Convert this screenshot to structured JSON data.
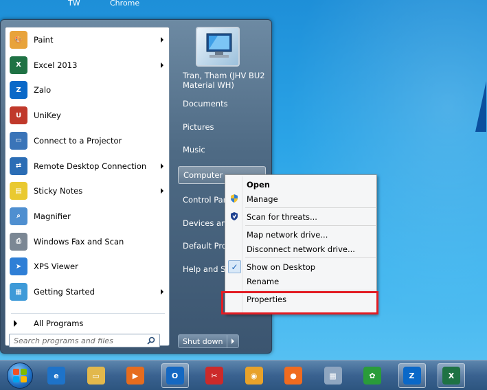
{
  "top_labels": [
    "TW",
    "Chrome"
  ],
  "start_menu": {
    "programs": [
      {
        "label": "Paint",
        "icon": "paint-icon",
        "color": "#e8a33b",
        "glyph": "🎨",
        "submenu": true
      },
      {
        "label": "Excel 2013",
        "icon": "excel-icon",
        "color": "#1f7244",
        "glyph": "X",
        "submenu": true
      },
      {
        "label": "Zalo",
        "icon": "zalo-icon",
        "color": "#0a68c8",
        "glyph": "Z",
        "submenu": false
      },
      {
        "label": "UniKey",
        "icon": "unikey-icon",
        "color": "#c0392b",
        "glyph": "U",
        "submenu": false
      },
      {
        "label": "Connect to a Projector",
        "icon": "projector-icon",
        "color": "#3a74b8",
        "glyph": "▭",
        "submenu": false
      },
      {
        "label": "Remote Desktop Connection",
        "icon": "remote-desktop-icon",
        "color": "#2b6db5",
        "glyph": "⇄",
        "submenu": true
      },
      {
        "label": "Sticky Notes",
        "icon": "sticky-notes-icon",
        "color": "#e9c930",
        "glyph": "▤",
        "submenu": true
      },
      {
        "label": "Magnifier",
        "icon": "magnifier-icon",
        "color": "#4f8fd0",
        "glyph": "⌕",
        "submenu": false
      },
      {
        "label": "Windows Fax and Scan",
        "icon": "fax-scan-icon",
        "color": "#7b8794",
        "glyph": "⎙",
        "submenu": false
      },
      {
        "label": "XPS Viewer",
        "icon": "xps-viewer-icon",
        "color": "#2f7fd6",
        "glyph": "➤",
        "submenu": false
      },
      {
        "label": "Getting Started",
        "icon": "getting-started-icon",
        "color": "#3e9ad8",
        "glyph": "▦",
        "submenu": true
      }
    ],
    "all_programs_label": "All Programs",
    "search_placeholder": "Search programs and files",
    "right_items": [
      {
        "label": "Tran, Tham (JHV BU2 Material WH)",
        "kind": "user"
      },
      {
        "label": "Documents"
      },
      {
        "label": "Pictures"
      },
      {
        "label": "Music"
      },
      {
        "label": "Computer",
        "highlight": true
      },
      {
        "label": "Control Panel"
      },
      {
        "label": "Devices and Printers"
      },
      {
        "label": "Default Programs"
      },
      {
        "label": "Help and Support"
      }
    ],
    "shutdown_label": "Shut down"
  },
  "context_menu": {
    "items": [
      {
        "label": "Open",
        "bold": true
      },
      {
        "label": "Manage",
        "icon": "uac-shield-icon"
      },
      {
        "separator": true
      },
      {
        "label": "Scan for threats...",
        "icon": "defender-shield-icon"
      },
      {
        "separator": true
      },
      {
        "label": "Map network drive..."
      },
      {
        "label": "Disconnect network drive..."
      },
      {
        "separator": true
      },
      {
        "label": "Show on Desktop",
        "checked": true
      },
      {
        "label": "Rename"
      },
      {
        "separator": true
      },
      {
        "label": "Properties",
        "highlighted": true
      }
    ]
  },
  "taskbar": {
    "apps": [
      {
        "icon": "ie-icon",
        "color": "#1e73c9",
        "glyph": "e"
      },
      {
        "icon": "file-explorer-icon",
        "color": "#e2b84c",
        "glyph": "▭"
      },
      {
        "icon": "media-player-icon",
        "color": "#e66c1e",
        "glyph": "▶"
      },
      {
        "icon": "outlook-icon",
        "color": "#1468c2",
        "glyph": "O",
        "active": true
      },
      {
        "icon": "snipping-tool-icon",
        "color": "#cc2a2a",
        "glyph": "✂"
      },
      {
        "icon": "chrome-icon",
        "color": "#e8a22a",
        "glyph": "◉"
      },
      {
        "icon": "firefox-icon",
        "color": "#f06b1f",
        "glyph": "●"
      },
      {
        "icon": "calculator-icon",
        "color": "#8fa6c0",
        "glyph": "▦"
      },
      {
        "icon": "colorful-app-icon",
        "color": "#2a9c3a",
        "glyph": "✿"
      },
      {
        "icon": "zalo-taskbar-icon",
        "color": "#0a68c8",
        "glyph": "Z",
        "active": true
      },
      {
        "icon": "excel-taskbar-icon",
        "color": "#1f7244",
        "glyph": "X",
        "active": true
      }
    ]
  }
}
